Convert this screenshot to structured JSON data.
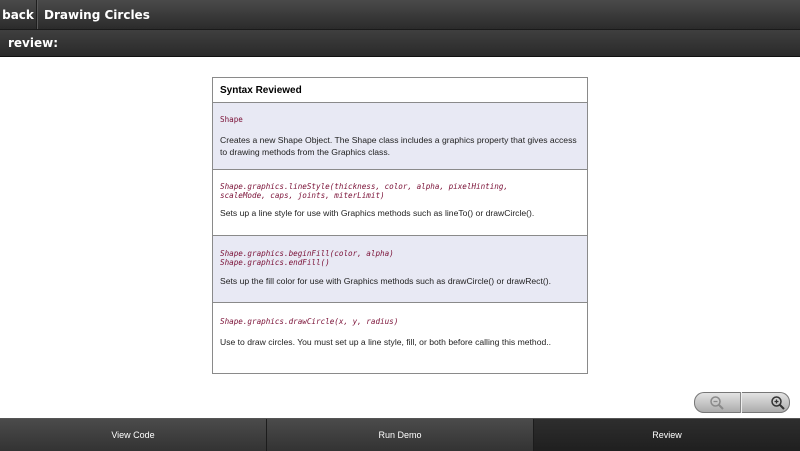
{
  "titlebar": {
    "back_label": "back",
    "title": "Drawing Circles"
  },
  "subbar": {
    "label": "review:"
  },
  "syntax_table": {
    "header": "Syntax Reviewed",
    "rows": [
      {
        "code": "Shape",
        "description": "Creates a new Shape Object. The Shape class includes a graphics property that gives access to drawing methods from the Graphics class."
      },
      {
        "code": "Shape.graphics.lineStyle(thickness, color, alpha, pixelHinting,\nscaleMode, caps, joints, miterLimit)",
        "description": "Sets up a line style for use with Graphics methods such as lineTo() or drawCircle()."
      },
      {
        "code": "Shape.graphics.beginFill(color, alpha)\nShape.graphics.endFill()",
        "description": "Sets up the fill color for use with Graphics methods such as drawCircle() or drawRect()."
      },
      {
        "code": "Shape.graphics.drawCircle(x, y, radius)",
        "description": "Use to draw circles. You must set up a line style, fill, or both before calling this method.."
      }
    ]
  },
  "zoom": {
    "out_icon": "zoom-out-icon",
    "in_icon": "zoom-in-icon"
  },
  "tabs": [
    {
      "label": "View Code",
      "active": false
    },
    {
      "label": "Run Demo",
      "active": false
    },
    {
      "label": "Review",
      "active": true
    }
  ],
  "colors": {
    "code_text": "#7a1036",
    "row_shade": "#e8e9f4",
    "bar_dark": "#2b2b2b"
  }
}
